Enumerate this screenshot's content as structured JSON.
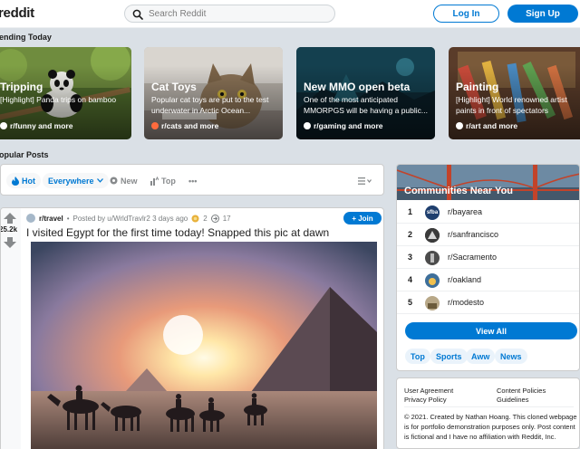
{
  "header": {
    "logo": "reddit",
    "search_placeholder": "Search Reddit",
    "login_label": "Log In",
    "signup_label": "Sign Up"
  },
  "trending": {
    "label": "ending Today",
    "cards": [
      {
        "title": "Tripping",
        "desc": "[Highlight] Panda trips on bamboo",
        "sub": "r/funny and more"
      },
      {
        "title": "Cat Toys",
        "desc": "Popular cat toys are put to the test underwater in Arctic Ocean...",
        "sub": "r/cats and more"
      },
      {
        "title": "New MMO open beta",
        "desc": "One of the most anticipated MMORPGS will be having a public...",
        "sub": "r/gaming and more"
      },
      {
        "title": "Painting",
        "desc": "[Highlight] World renowned artist paints in front of spectators",
        "sub": "r/art and more"
      }
    ]
  },
  "popular": {
    "label": "opular Posts"
  },
  "sortbar": {
    "hot": "Hot",
    "everywhere": "Everywhere",
    "new": "New",
    "top": "Top",
    "more": "•••"
  },
  "post": {
    "votes": "25.2k",
    "subreddit": "r/travel",
    "bullet": "•",
    "posted_by": "Posted by u/WrldTravlr2 3 days ago",
    "award_count": "2",
    "share_count": "17",
    "join_label": "+ Join",
    "title": "I visited Egypt for the first time today! Snapped this pic at dawn"
  },
  "communities": {
    "title": "Communities Near You",
    "items": [
      {
        "rank": "1",
        "name": "r/bayarea",
        "icon_text": "sfba"
      },
      {
        "rank": "2",
        "name": "r/sanfrancisco",
        "icon_text": ""
      },
      {
        "rank": "3",
        "name": "r/Sacramento",
        "icon_text": ""
      },
      {
        "rank": "4",
        "name": "r/oakland",
        "icon_text": ""
      },
      {
        "rank": "5",
        "name": "r/modesto",
        "icon_text": ""
      }
    ],
    "view_all": "View All",
    "chips": [
      "Top",
      "Sports",
      "Aww",
      "News"
    ]
  },
  "footer": {
    "user_agreement": "User Agreement",
    "privacy_policy": "Privacy Policy",
    "content_policies": "Content Policies",
    "guidelines": "Guidelines",
    "copyright": "© 2021. Created by Nathan Hoang. This cloned webpage is for portfolio demonstration purposes only. Post content is fictional and I have no affiliation with Reddit, Inc."
  },
  "colors": {
    "accent": "#0079d3",
    "background": "#dae0e6",
    "upvote_green": "#46d160"
  }
}
